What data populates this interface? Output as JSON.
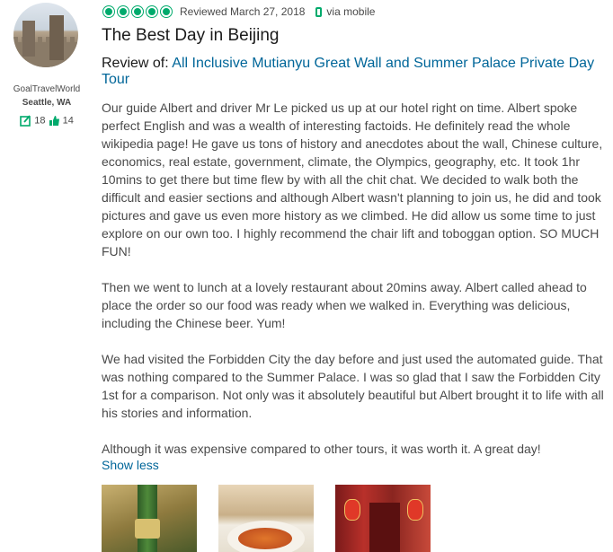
{
  "reviewer": {
    "username": "GoalTravelWorld",
    "location": "Seattle, WA",
    "reviews_count": "18",
    "helpful_votes": "14"
  },
  "review": {
    "rating_bubbles": 5,
    "rating_color": "#00aa6c",
    "reviewed_date": "Reviewed March 27, 2018",
    "via": "via mobile",
    "title": "The Best Day in Beijing",
    "review_of_label": "Review of:",
    "tour_name": "All Inclusive Mutianyu Great Wall and Summer Palace Private Day Tour",
    "paragraphs": [
      "Our guide Albert and driver Mr Le picked us up at our hotel right on time. Albert spoke perfect English and was a wealth of interesting factoids. He definitely read the whole wikipedia page! He gave us tons of history and anecdotes about the wall, Chinese culture, economics, real estate, government, climate, the Olympics, geography, etc. It took 1hr 10mins to get there but time flew by with all the chit chat. We decided to walk both the difficult and easier sections and although Albert wasn't planning to join us, he did and took pictures and gave us even more history as we climbed. He did allow us some time to just explore on our own too. I highly recommend the chair lift and toboggan option. SO MUCH FUN!",
      "Then we went to lunch at a lovely restaurant about 20mins away. Albert called ahead to place the order so our food was ready when we walked in. Everything was delicious, including the Chinese beer. Yum!",
      "We had visited the Forbidden City the day before and just used the automated guide. That was nothing compared to the Summer Palace. I was so glad that I saw the Forbidden City 1st for a comparison. Not only was it absolutely beautiful but Albert brought it to life with all his stories and information.",
      "Although it was expensive compared to other tours, it was worth it. A great day!"
    ],
    "show_less": "Show less"
  },
  "colors": {
    "link": "#006699",
    "accent": "#00aa6c"
  }
}
